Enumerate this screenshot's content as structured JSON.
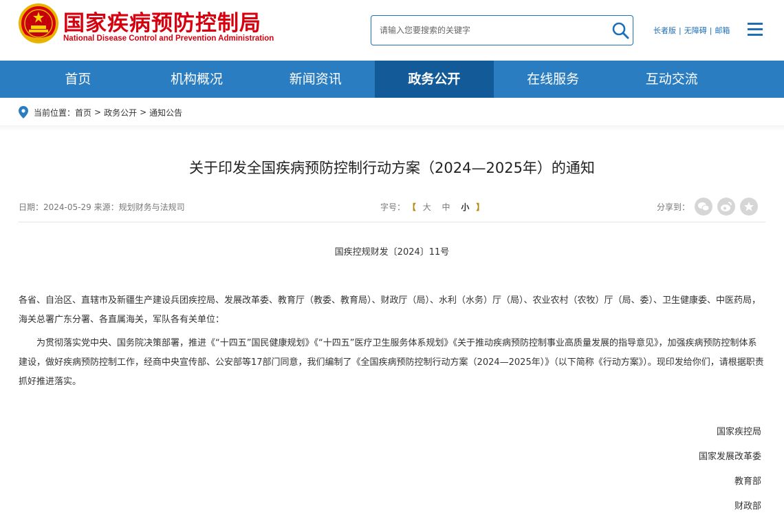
{
  "header": {
    "logo_cn": "国家疾病预防控制局",
    "logo_en": "National Disease Control and Prevention Administration",
    "search": {
      "placeholder": "请输入您要搜索的关键字"
    },
    "top_links": [
      "长者版",
      "无障碍",
      "邮箱"
    ],
    "brand_color": "#d7000f",
    "accent_color": "#1d6fb8"
  },
  "nav": {
    "items": [
      "首页",
      "机构概况",
      "新闻资讯",
      "政务公开",
      "在线服务",
      "互动交流"
    ],
    "active": "政务公开",
    "bg_color": "#2b7dc1",
    "active_color": "#125a98"
  },
  "breadcrumb": {
    "prefix": "当前位置：",
    "items": [
      "首页",
      "政务公开",
      "通知公告"
    ],
    "separator": ">"
  },
  "article": {
    "title": "关于印发全国疾病预防控制行动方案（2024—2025年）的通知",
    "date_label": "日期：",
    "date": "2024-05-29",
    "source_label": "来源：",
    "source": "规划财务与法规司",
    "font_size_label": "字号：",
    "font_sizes": [
      "大",
      "中",
      "小"
    ],
    "bracket_open": "【",
    "bracket_close": "】",
    "share_label": "分享到：",
    "share_icons": [
      "wechat-icon",
      "weibo-icon",
      "star-icon"
    ],
    "doc_number": "国疾控规财发〔2024〕11号",
    "paragraphs": [
      "各省、自治区、直辖市及新疆生产建设兵团疾控局、发展改革委、教育厅（教委、教育局）、财政厅（局）、水利（水务）厅（局）、农业农村（农牧）厅（局、委）、卫生健康委、中医药局，海关总署广东分署、各直属海关，军队各有关单位：",
      "为贯彻落实党中央、国务院决策部署，推进《“十四五”国民健康规划》《“十四五”医疗卫生服务体系规划》《关于推动疾病预防控制事业高质量发展的指导意见》，加强疾病预防控制体系建设，做好疾病预防控制工作，经商中央宣传部、公安部等17部门同意，我们编制了《全国疾病预防控制行动方案（2024—2025年）》（以下简称《行动方案》）。现印发给你们，请根据职责抓好推进落实。"
    ],
    "signatures": [
      "国家疾控局",
      "国家发展改革委",
      "教育部",
      "财政部"
    ]
  }
}
